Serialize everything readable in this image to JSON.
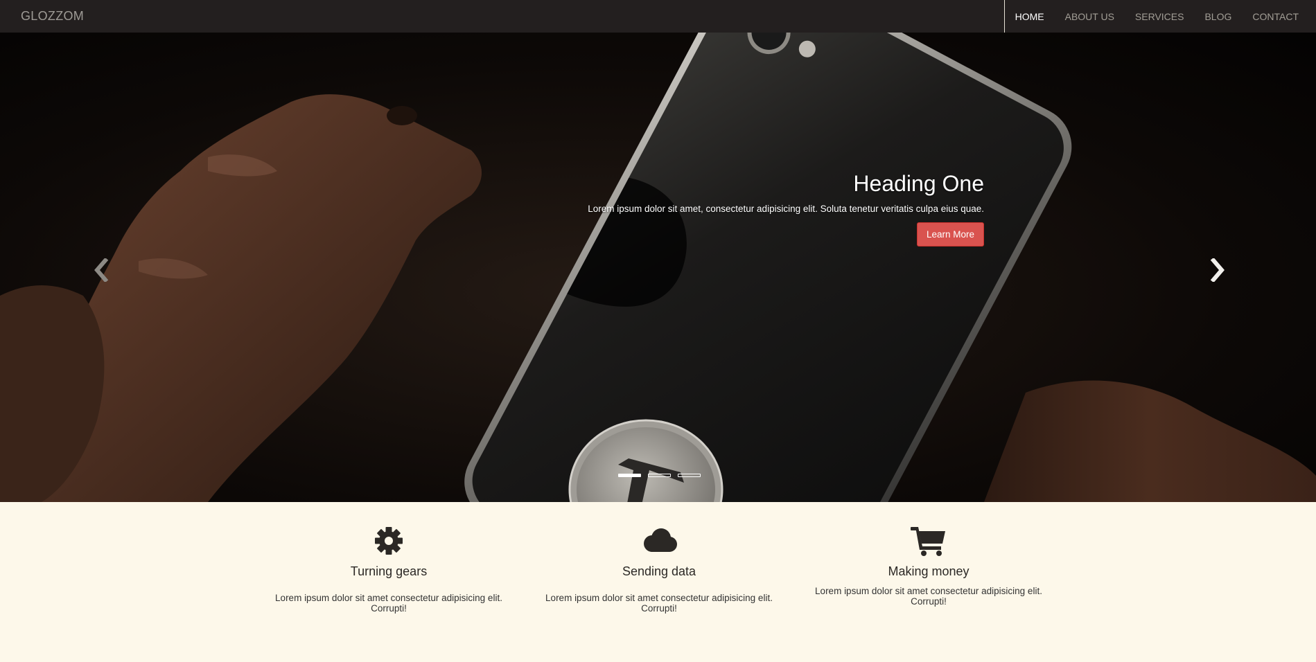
{
  "navbar": {
    "brand": "GLOZZOM",
    "items": [
      {
        "label": "HOME",
        "active": true
      },
      {
        "label": "ABOUT US",
        "active": false
      },
      {
        "label": "SERVICES",
        "active": false
      },
      {
        "label": "BLOG",
        "active": false
      },
      {
        "label": "CONTACT",
        "active": false
      }
    ]
  },
  "carousel": {
    "heading": "Heading One",
    "text": "Lorem ipsum dolor sit amet, consectetur adipisicing elit. Soluta tenetur veritatis culpa eius quae.",
    "button_label": "Learn More",
    "prev_icon": "chevron-left-icon",
    "next_icon": "chevron-right-icon",
    "slide_count": 3,
    "active_slide": 1
  },
  "features": [
    {
      "icon": "gear-icon",
      "title": "Turning gears",
      "text": "Lorem ipsum dolor sit amet consectetur adipisicing elit. Corrupti!"
    },
    {
      "icon": "cloud-icon",
      "title": "Sending data",
      "text": "Lorem ipsum dolor sit amet consectetur adipisicing elit. Corrupti!"
    },
    {
      "icon": "cart-icon",
      "title": "Making money",
      "text": "Lorem ipsum dolor sit amet consectetur adipisicing elit. Corrupti!"
    }
  ],
  "colors": {
    "navbar_bg": "#231f1f",
    "accent_button": "#d9534f",
    "features_bg": "#fdf8ea"
  }
}
